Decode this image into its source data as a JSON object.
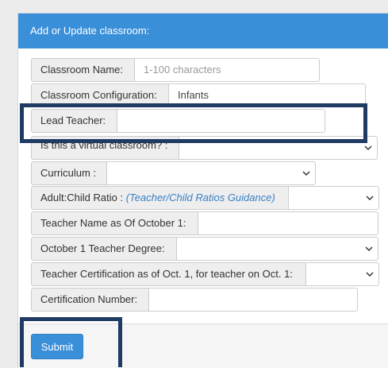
{
  "panel": {
    "title": "Add or Update classroom:"
  },
  "form": {
    "classroom_name": {
      "label": "Classroom Name:",
      "placeholder": "1-100 characters"
    },
    "classroom_configuration": {
      "label": "Classroom Configuration:",
      "value": "Infants"
    },
    "lead_teacher": {
      "label": "Lead Teacher:",
      "value": ""
    },
    "virtual_classroom": {
      "label": "Is this a virtual classroom? :",
      "value": ""
    },
    "curriculum": {
      "label": "Curriculum :",
      "value": ""
    },
    "ratio": {
      "label": "Adult:Child Ratio :",
      "link": "(Teacher/Child Ratios Guidance)",
      "value": ""
    },
    "teacher_name_oct1": {
      "label": "Teacher Name as Of October 1:",
      "value": ""
    },
    "teacher_degree_oct1": {
      "label": "October 1 Teacher Degree:",
      "value": ""
    },
    "teacher_cert_oct1": {
      "label": "Teacher Certification as of Oct. 1, for teacher on Oct. 1:",
      "value": ""
    },
    "certification_number": {
      "label": "Certification Number:",
      "value": ""
    }
  },
  "footer": {
    "submit_label": "Submit"
  },
  "colors": {
    "header": "#3a8fd9",
    "highlight": "#1f3b63",
    "link": "#3a7fc4"
  }
}
